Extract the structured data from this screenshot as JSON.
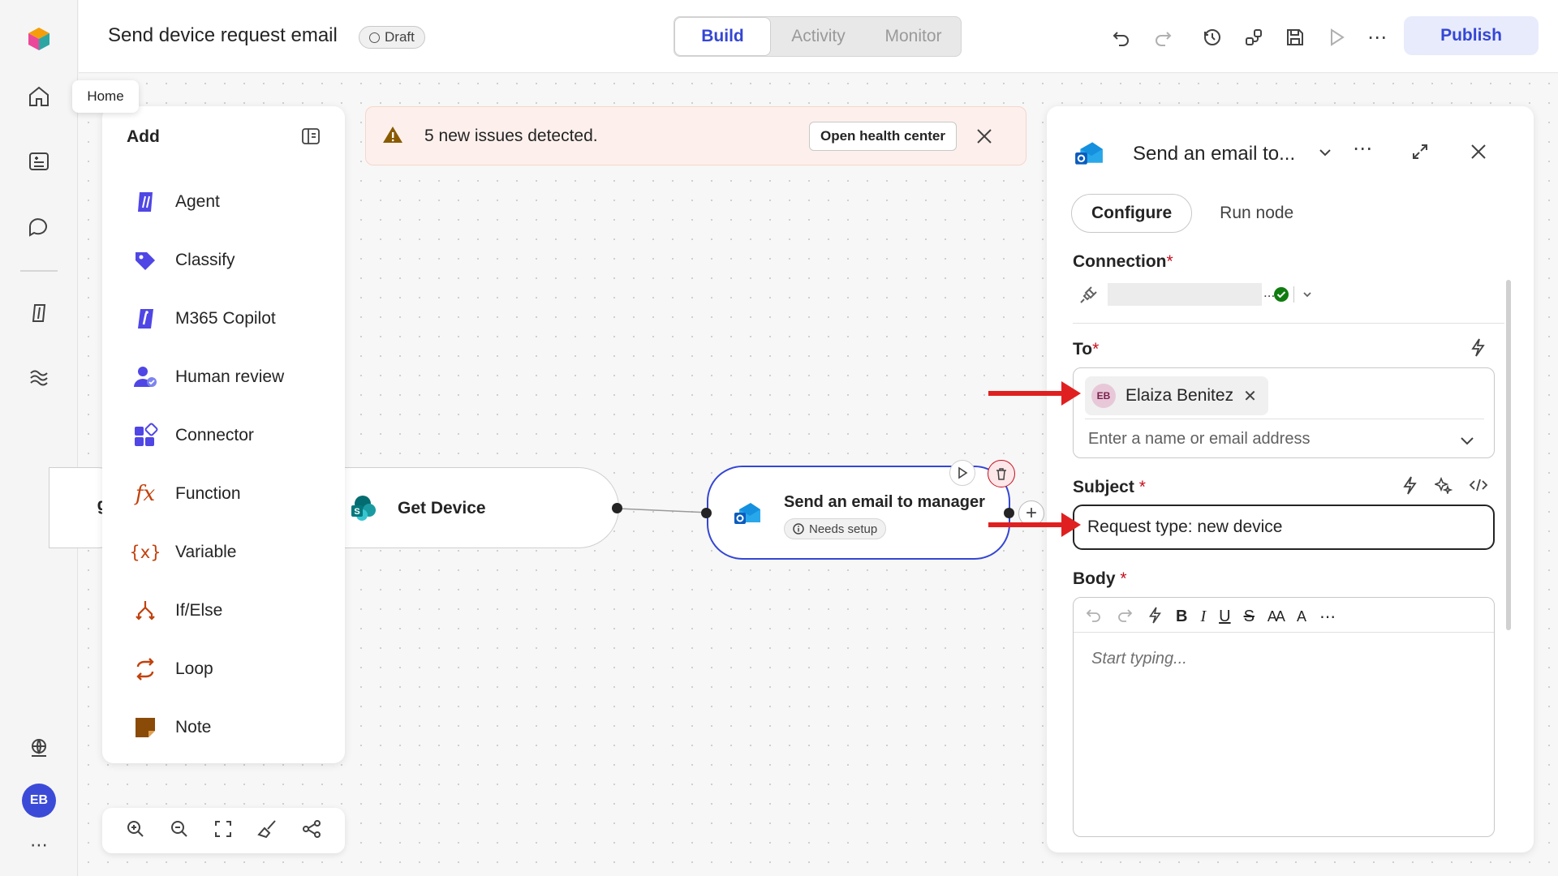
{
  "app": {
    "title": "Send device request email",
    "status": "Draft",
    "tabs": [
      "Build",
      "Activity",
      "Monitor"
    ],
    "active_tab": "Build",
    "publish_label": "Publish"
  },
  "rail": {
    "tooltip": "Home",
    "avatar_initials": "EB",
    "items": [
      "home-icon",
      "news-icon",
      "chat-icon",
      "agent-icon",
      "flows-icon",
      "globe-icon"
    ]
  },
  "add_panel": {
    "title": "Add",
    "items": [
      {
        "label": "Agent",
        "icon": "agent-icon",
        "color": "#4f46e5"
      },
      {
        "label": "Classify",
        "icon": "tag-icon",
        "color": "#4f46e5"
      },
      {
        "label": "M365 Copilot",
        "icon": "copilot-icon",
        "color": "#4f46e5"
      },
      {
        "label": "Human review",
        "icon": "person-icon",
        "color": "#4f46e5"
      },
      {
        "label": "Connector",
        "icon": "connector-icon",
        "color": "#4f46e5"
      },
      {
        "label": "Function",
        "icon": "fx-icon",
        "color": "#c2410c"
      },
      {
        "label": "Variable",
        "icon": "variable-icon",
        "color": "#c2410c"
      },
      {
        "label": "If/Else",
        "icon": "branch-icon",
        "color": "#c2410c"
      },
      {
        "label": "Loop",
        "icon": "loop-icon",
        "color": "#c2410c"
      },
      {
        "label": "Note",
        "icon": "note-icon",
        "color": "#8a4b08"
      }
    ]
  },
  "banner": {
    "message": "5 new issues detected.",
    "action_label": "Open health center"
  },
  "nodes": {
    "partial_label": "gen",
    "get_device": "Get Device",
    "send_email": "Send an email to manager",
    "needs_setup": "Needs setup"
  },
  "right_panel": {
    "title": "Send an email to...",
    "tabs": [
      "Configure",
      "Run node"
    ],
    "connection_label": "Connection",
    "connection_value": "...",
    "to_label": "To",
    "to_chip_initials": "EB",
    "to_chip_name": "Elaiza Benitez",
    "to_placeholder": "Enter a name or email address",
    "subject_label": "Subject",
    "subject_value": "Request type: new device",
    "body_label": "Body",
    "body_placeholder": "Start typing...",
    "required_mark": "*"
  },
  "colors": {
    "accent": "#3446d4",
    "annotation_arrow": "#e02020",
    "banner_bg": "#fdf0ec",
    "connected_ok": "#107c10"
  }
}
